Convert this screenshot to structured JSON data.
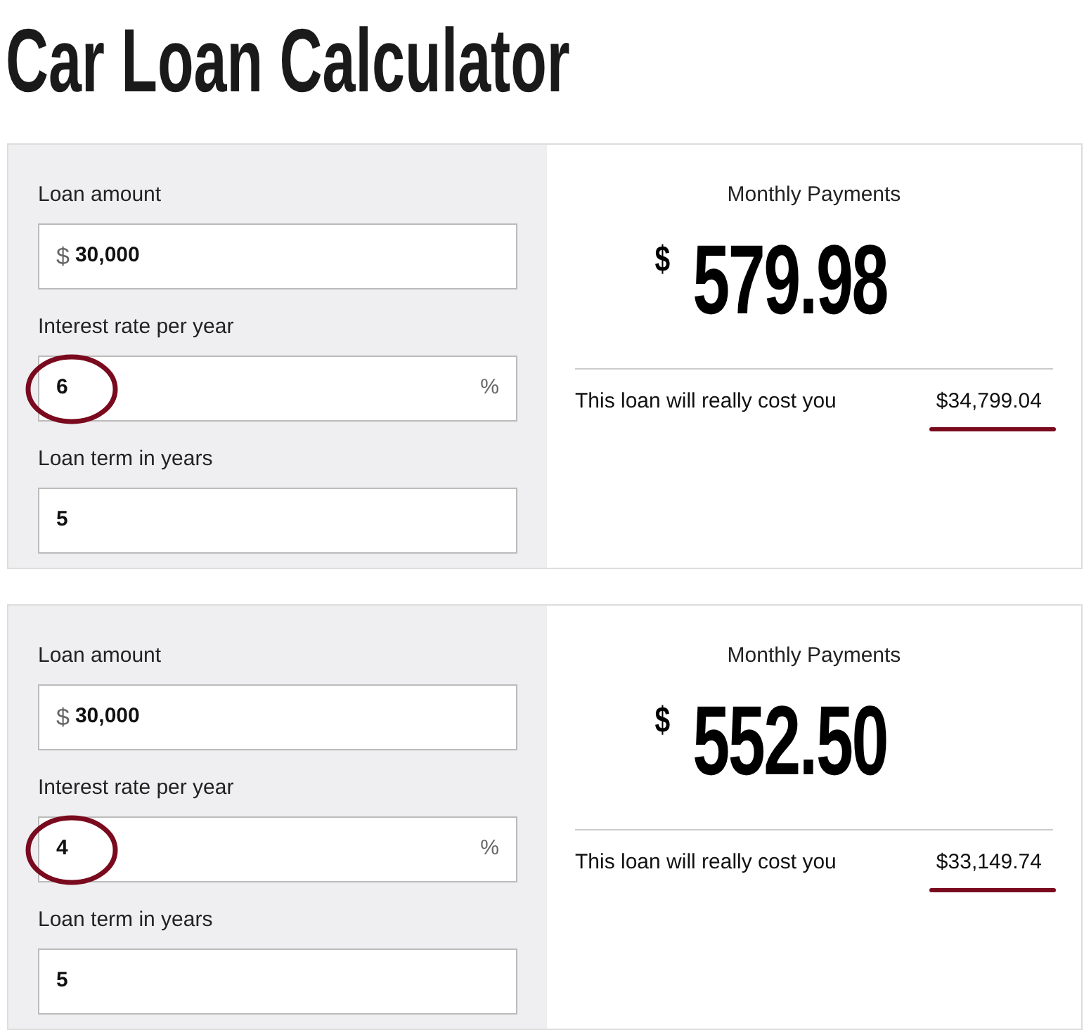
{
  "title": "Car Loan Calculator",
  "calculators": [
    {
      "fields": [
        {
          "label": "Loan amount",
          "prefix": "$",
          "value": "30,000",
          "circled": false
        },
        {
          "label": "Interest rate per year",
          "suffix": "%",
          "value": "6",
          "circled": true
        },
        {
          "label": "Loan term in years",
          "value": "5",
          "circled": false
        }
      ],
      "result_label": "Monthly Payments",
      "currency": "$",
      "monthly": "579.98",
      "cost_label": "This loan will really cost you",
      "total": "$34,799.04",
      "underlined": true
    },
    {
      "fields": [
        {
          "label": "Loan amount",
          "prefix": "$",
          "value": "30,000",
          "circled": false
        },
        {
          "label": "Interest rate per year",
          "suffix": "%",
          "value": "4",
          "circled": true
        },
        {
          "label": "Loan term in years",
          "value": "5",
          "circled": false
        }
      ],
      "result_label": "Monthly Payments",
      "currency": "$",
      "monthly": "552.50",
      "cost_label": "This loan will really cost you",
      "total": "$33,149.74",
      "underlined": true
    }
  ]
}
